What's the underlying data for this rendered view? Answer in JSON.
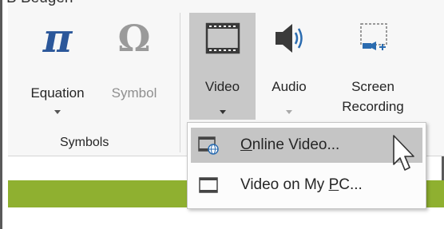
{
  "top_partial_text": "B Beugen",
  "insert_ribbon": {
    "symbols_group": {
      "label": "Symbols",
      "equation": {
        "glyph": "π",
        "label": "Equation"
      },
      "symbol": {
        "glyph": "Ω",
        "label": "Symbol"
      }
    },
    "media_group": {
      "video": {
        "label": "Video"
      },
      "audio": {
        "label": "Audio"
      },
      "screen_recording": {
        "label_line1": "Screen",
        "label_line2": "Recording"
      }
    }
  },
  "video_menu": {
    "items": [
      {
        "prefix": "",
        "accel": "O",
        "suffix": "nline Video...",
        "icon": "online-video-icon"
      },
      {
        "prefix": "Video on My ",
        "accel": "P",
        "suffix": "C...",
        "icon": "film-icon"
      }
    ]
  },
  "colors": {
    "accent_bar": "#8fb030",
    "hover": "#c5c5c5",
    "selected_button": "#c8c8c8"
  }
}
